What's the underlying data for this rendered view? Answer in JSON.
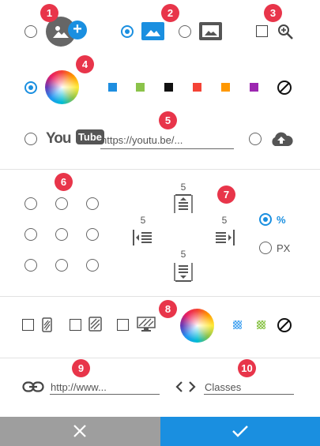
{
  "badges": [
    "1",
    "2",
    "3",
    "4",
    "5",
    "6",
    "7",
    "8",
    "9",
    "10"
  ],
  "background": {
    "image_type_selected": "image",
    "zoom_checked": false
  },
  "color": {
    "swatches": [
      "#1e8ee0",
      "#8bc34a",
      "#111111",
      "#f44336",
      "#ff9800",
      "#9c27b0"
    ],
    "selected_mode": "color"
  },
  "video": {
    "youtube_logo": "You",
    "youtube_tube": "Tube",
    "url_placeholder": "https://youtu.be/..."
  },
  "position": {
    "selected": null
  },
  "padding": {
    "top": "5",
    "left": "5",
    "right": "5",
    "bottom": "5",
    "unit_percent": "%",
    "unit_px": "PX",
    "selected_unit": "%"
  },
  "overlay": {
    "swatches": [
      "#4ea7f0",
      "#8bc34a"
    ]
  },
  "link": {
    "url_placeholder": "http://www...",
    "classes_placeholder": "Classes"
  },
  "footer": {
    "cancel_color": "#9e9e9e",
    "confirm_color": "#1a8fe0"
  }
}
